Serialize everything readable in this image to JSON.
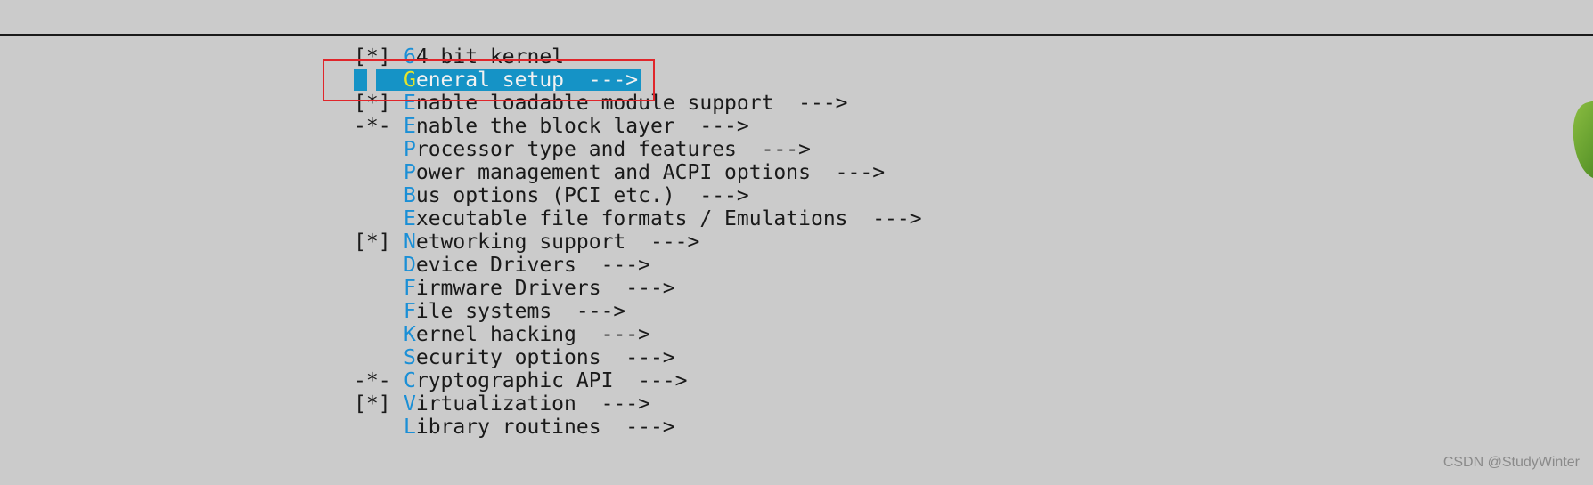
{
  "menu": {
    "items": [
      {
        "prefix": "[*]",
        "hotkey": "6",
        "rest": "4 bit kernel",
        "selected": false
      },
      {
        "prefix": "",
        "hotkey": "G",
        "rest": "eneral setup  --->",
        "selected": true
      },
      {
        "prefix": "[*]",
        "hotkey": "E",
        "rest": "nable loadable module support  --->",
        "selected": false
      },
      {
        "prefix": "-*-",
        "hotkey": "E",
        "rest": "nable the block layer  --->",
        "selected": false
      },
      {
        "prefix": "",
        "hotkey": "P",
        "rest": "rocessor type and features  --->",
        "selected": false
      },
      {
        "prefix": "",
        "hotkey": "P",
        "rest": "ower management and ACPI options  --->",
        "selected": false
      },
      {
        "prefix": "",
        "hotkey": "B",
        "rest": "us options (PCI etc.)  --->",
        "selected": false
      },
      {
        "prefix": "",
        "hotkey": "E",
        "rest": "xecutable file formats / Emulations  --->",
        "selected": false
      },
      {
        "prefix": "[*]",
        "hotkey": "N",
        "rest": "etworking support  --->",
        "selected": false
      },
      {
        "prefix": "",
        "hotkey": "D",
        "rest": "evice Drivers  --->",
        "selected": false
      },
      {
        "prefix": "",
        "hotkey": "F",
        "rest": "irmware Drivers  --->",
        "selected": false
      },
      {
        "prefix": "",
        "hotkey": "F",
        "rest": "ile systems  --->",
        "selected": false
      },
      {
        "prefix": "",
        "hotkey": "K",
        "rest": "ernel hacking  --->",
        "selected": false
      },
      {
        "prefix": "",
        "hotkey": "S",
        "rest": "ecurity options  --->",
        "selected": false
      },
      {
        "prefix": "-*-",
        "hotkey": "C",
        "rest": "ryptographic API  --->",
        "selected": false
      },
      {
        "prefix": "[*]",
        "hotkey": "V",
        "rest": "irtualization  --->",
        "selected": false
      },
      {
        "prefix": "",
        "hotkey": "L",
        "rest": "ibrary routines  --->",
        "selected": false
      }
    ]
  },
  "watermark": "CSDN @StudyWinter",
  "colors": {
    "background": "#cbcbcb",
    "selection": "#1593c6",
    "hotkey": "#1a8fd6",
    "selected_hotkey": "#e7e52a",
    "annotation_box": "#e0262b"
  }
}
